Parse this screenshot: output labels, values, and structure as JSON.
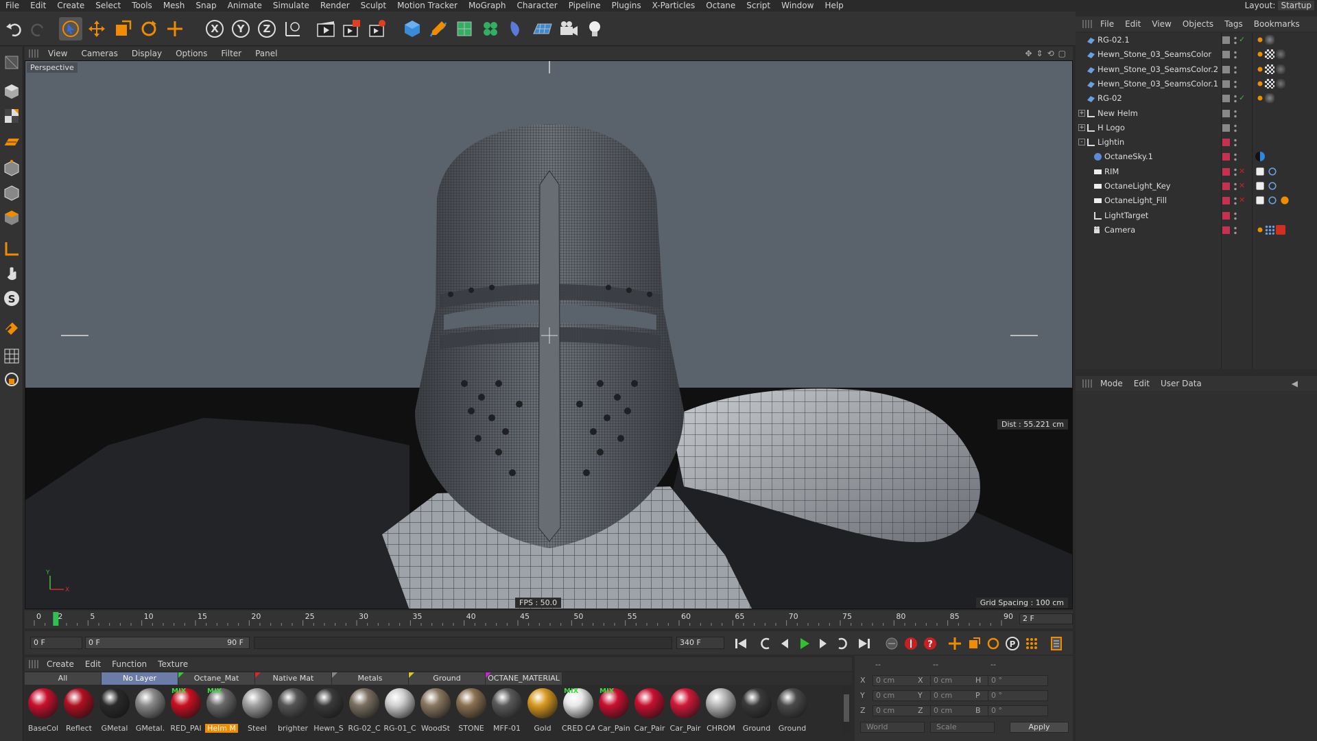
{
  "menubar": {
    "items": [
      "File",
      "Edit",
      "Create",
      "Select",
      "Tools",
      "Mesh",
      "Snap",
      "Animate",
      "Simulate",
      "Render",
      "Sculpt",
      "Motion Tracker",
      "MoGraph",
      "Character",
      "Pipeline",
      "Plugins",
      "X-Particles",
      "Octane",
      "Script",
      "Window",
      "Help"
    ],
    "layout_label": "Layout:",
    "layout_value": "Startup"
  },
  "toolbar": {
    "icons": [
      "undo-icon",
      "redo-icon",
      "select-arrow-icon",
      "move-icon",
      "scale-icon",
      "rotate-icon",
      "transform-icon",
      "x-axis-icon",
      "y-axis-icon",
      "z-axis-icon",
      "coordinate-system-icon",
      "render-view-icon",
      "render-picture-viewer-icon",
      "render-settings-icon",
      "cube-icon",
      "pen-icon",
      "subdivision-icon",
      "cloner-icon",
      "deformer-icon",
      "floor-icon",
      "camera-icon",
      "light-icon"
    ]
  },
  "viewport": {
    "menu": [
      "View",
      "Cameras",
      "Display",
      "Options",
      "Filter",
      "Panel"
    ],
    "label": "Perspective",
    "dist": "Dist : 55.221 cm",
    "fps": "FPS : 50.0",
    "grid_spacing": "Grid Spacing : 100 cm",
    "bg_color": "#5a626b",
    "floor_color": "#111111"
  },
  "timeline": {
    "ticks": [
      "0",
      "2",
      "5",
      "10",
      "15",
      "20",
      "25",
      "30",
      "35",
      "40",
      "45",
      "50",
      "55",
      "60",
      "65",
      "70",
      "75",
      "80",
      "85",
      "90"
    ],
    "current_frame": "2 F",
    "start_field": "0 F",
    "range_start": "0 F",
    "range_end": "90 F",
    "end_field": "340 F"
  },
  "material_manager": {
    "menu": [
      "Create",
      "Edit",
      "Function",
      "Texture"
    ],
    "tabs": [
      {
        "label": "All",
        "flag": ""
      },
      {
        "label": "No Layer",
        "flag": "",
        "active": true
      },
      {
        "label": "Octane_Mat",
        "flag": "#3cc83c"
      },
      {
        "label": "Native Mat",
        "flag": "#d82828"
      },
      {
        "label": "Metals",
        "flag": "#888888"
      },
      {
        "label": "Ground",
        "flag": "#d8c828"
      },
      {
        "label": "OCTANE_MATERIAL",
        "flag": "#c828c8"
      }
    ],
    "materials": [
      {
        "name": "BaseCol",
        "color": "#c8102e",
        "mix": false
      },
      {
        "name": "Reflect",
        "color": "#b01020",
        "mix": false
      },
      {
        "name": "GMetal",
        "color": "#2a2a2a",
        "mix": false
      },
      {
        "name": "GMetal.",
        "color": "#8a8a8a",
        "mix": false
      },
      {
        "name": "RED_PAI",
        "color": "#c81020",
        "mix": true
      },
      {
        "name": "Helm M",
        "color": "#6a6a6a",
        "mix": true,
        "selected": true
      },
      {
        "name": "Steel",
        "color": "#a0a0a0",
        "mix": false
      },
      {
        "name": "brighter",
        "color": "#555555",
        "mix": false
      },
      {
        "name": "Hewn_S",
        "color": "#3a3a3a",
        "mix": false
      },
      {
        "name": "RG-02_C",
        "color": "#7a7060",
        "mix": false
      },
      {
        "name": "RG-01_C",
        "color": "#d0d0d0",
        "mix": false
      },
      {
        "name": "WoodSt",
        "color": "#8a7860",
        "mix": false
      },
      {
        "name": "STONE",
        "color": "#8a7050",
        "mix": false
      },
      {
        "name": "MFF-01",
        "color": "#5a5a5a",
        "mix": false
      },
      {
        "name": "Gold",
        "color": "#d89a20",
        "mix": false
      },
      {
        "name": "CRED CA",
        "color": "#e8e8e8",
        "mix": true
      },
      {
        "name": "Car_Pain",
        "color": "#c81030",
        "mix": true
      },
      {
        "name": "Car_Pair",
        "color": "#c81030",
        "mix": false
      },
      {
        "name": "Car_Pair",
        "color": "#d01838",
        "mix": false
      },
      {
        "name": "CHROM",
        "color": "#b8b8b8",
        "mix": false
      },
      {
        "name": "Ground",
        "color": "#3a3a3a",
        "mix": false
      },
      {
        "name": "Ground",
        "color": "#4a4a4a",
        "mix": false
      }
    ]
  },
  "coordinates": {
    "headers": [
      "--",
      "--",
      "--"
    ],
    "rows": [
      {
        "a": "X",
        "av": "0 cm",
        "b": "X",
        "bv": "0 cm",
        "c": "H",
        "cv": "0 °"
      },
      {
        "a": "Y",
        "av": "0 cm",
        "b": "Y",
        "bv": "0 cm",
        "c": "P",
        "cv": "0 °"
      },
      {
        "a": "Z",
        "av": "0 cm",
        "b": "Z",
        "bv": "0 cm",
        "c": "B",
        "cv": "0 °"
      }
    ],
    "mode1": "World",
    "mode2": "Scale",
    "apply": "Apply"
  },
  "object_manager": {
    "menu": [
      "File",
      "Edit",
      "View",
      "Objects",
      "Tags",
      "Bookmarks"
    ],
    "objects": [
      {
        "name": "RG-02.1",
        "indent": 1,
        "icon": "mesh",
        "expand": ""
      },
      {
        "name": "Hewn_Stone_03_SeamsColor",
        "indent": 1,
        "icon": "mesh",
        "expand": ""
      },
      {
        "name": "Hewn_Stone_03_SeamsColor.2",
        "indent": 1,
        "icon": "mesh",
        "expand": ""
      },
      {
        "name": "Hewn_Stone_03_SeamsColor.1",
        "indent": 1,
        "icon": "mesh",
        "expand": ""
      },
      {
        "name": "RG-02",
        "indent": 1,
        "icon": "mesh",
        "expand": ""
      },
      {
        "name": "New Helm",
        "indent": 1,
        "icon": "null",
        "expand": "+"
      },
      {
        "name": "H Logo",
        "indent": 1,
        "icon": "null",
        "expand": "+"
      },
      {
        "name": "Lightin",
        "indent": 1,
        "icon": "null",
        "expand": "-"
      },
      {
        "name": "OctaneSky.1",
        "indent": 2,
        "icon": "sky",
        "expand": ""
      },
      {
        "name": "RIM",
        "indent": 2,
        "icon": "light",
        "expand": ""
      },
      {
        "name": "OctaneLight_Key",
        "indent": 2,
        "icon": "light",
        "expand": ""
      },
      {
        "name": "OctaneLight_Fill",
        "indent": 2,
        "icon": "light",
        "expand": ""
      },
      {
        "name": "LightTarget",
        "indent": 2,
        "icon": "null",
        "expand": ""
      },
      {
        "name": "Camera",
        "indent": 2,
        "icon": "camera",
        "expand": ""
      }
    ]
  },
  "attribute_manager": {
    "menu": [
      "Mode",
      "Edit",
      "User Data"
    ]
  }
}
